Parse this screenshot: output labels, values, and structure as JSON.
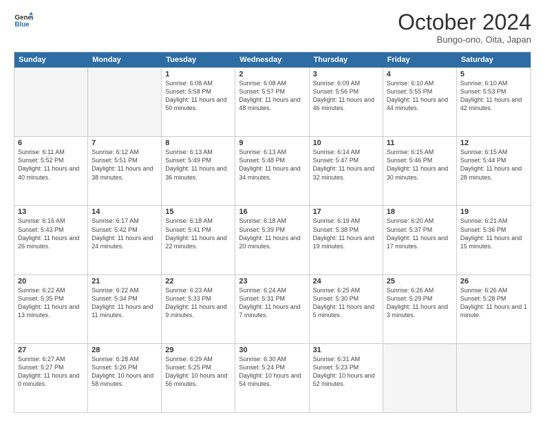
{
  "logo": {
    "line1": "General",
    "line2": "Blue"
  },
  "title": "October 2024",
  "location": "Bungo-ono, Oita, Japan",
  "header_days": [
    "Sunday",
    "Monday",
    "Tuesday",
    "Wednesday",
    "Thursday",
    "Friday",
    "Saturday"
  ],
  "rows": [
    [
      {
        "day": "",
        "info": ""
      },
      {
        "day": "",
        "info": ""
      },
      {
        "day": "1",
        "info": "Sunrise: 6:08 AM\nSunset: 5:58 PM\nDaylight: 11 hours and 50 minutes."
      },
      {
        "day": "2",
        "info": "Sunrise: 6:08 AM\nSunset: 5:57 PM\nDaylight: 11 hours and 48 minutes."
      },
      {
        "day": "3",
        "info": "Sunrise: 6:09 AM\nSunset: 5:56 PM\nDaylight: 11 hours and 46 minutes."
      },
      {
        "day": "4",
        "info": "Sunrise: 6:10 AM\nSunset: 5:55 PM\nDaylight: 11 hours and 44 minutes."
      },
      {
        "day": "5",
        "info": "Sunrise: 6:10 AM\nSunset: 5:53 PM\nDaylight: 11 hours and 42 minutes."
      }
    ],
    [
      {
        "day": "6",
        "info": "Sunrise: 6:11 AM\nSunset: 5:52 PM\nDaylight: 11 hours and 40 minutes."
      },
      {
        "day": "7",
        "info": "Sunrise: 6:12 AM\nSunset: 5:51 PM\nDaylight: 11 hours and 38 minutes."
      },
      {
        "day": "8",
        "info": "Sunrise: 6:13 AM\nSunset: 5:49 PM\nDaylight: 11 hours and 36 minutes."
      },
      {
        "day": "9",
        "info": "Sunrise: 6:13 AM\nSunset: 5:48 PM\nDaylight: 11 hours and 34 minutes."
      },
      {
        "day": "10",
        "info": "Sunrise: 6:14 AM\nSunset: 5:47 PM\nDaylight: 11 hours and 32 minutes."
      },
      {
        "day": "11",
        "info": "Sunrise: 6:15 AM\nSunset: 5:46 PM\nDaylight: 11 hours and 30 minutes."
      },
      {
        "day": "12",
        "info": "Sunrise: 6:15 AM\nSunset: 5:44 PM\nDaylight: 11 hours and 28 minutes."
      }
    ],
    [
      {
        "day": "13",
        "info": "Sunrise: 6:16 AM\nSunset: 5:43 PM\nDaylight: 11 hours and 26 minutes."
      },
      {
        "day": "14",
        "info": "Sunrise: 6:17 AM\nSunset: 5:42 PM\nDaylight: 11 hours and 24 minutes."
      },
      {
        "day": "15",
        "info": "Sunrise: 6:18 AM\nSunset: 5:41 PM\nDaylight: 11 hours and 22 minutes."
      },
      {
        "day": "16",
        "info": "Sunrise: 6:18 AM\nSunset: 5:39 PM\nDaylight: 11 hours and 20 minutes."
      },
      {
        "day": "17",
        "info": "Sunrise: 6:19 AM\nSunset: 5:38 PM\nDaylight: 11 hours and 19 minutes."
      },
      {
        "day": "18",
        "info": "Sunrise: 6:20 AM\nSunset: 5:37 PM\nDaylight: 11 hours and 17 minutes."
      },
      {
        "day": "19",
        "info": "Sunrise: 6:21 AM\nSunset: 5:36 PM\nDaylight: 11 hours and 15 minutes."
      }
    ],
    [
      {
        "day": "20",
        "info": "Sunrise: 6:22 AM\nSunset: 5:35 PM\nDaylight: 11 hours and 13 minutes."
      },
      {
        "day": "21",
        "info": "Sunrise: 6:22 AM\nSunset: 5:34 PM\nDaylight: 11 hours and 11 minutes."
      },
      {
        "day": "22",
        "info": "Sunrise: 6:23 AM\nSunset: 5:33 PM\nDaylight: 11 hours and 9 minutes."
      },
      {
        "day": "23",
        "info": "Sunrise: 6:24 AM\nSunset: 5:31 PM\nDaylight: 11 hours and 7 minutes."
      },
      {
        "day": "24",
        "info": "Sunrise: 6:25 AM\nSunset: 5:30 PM\nDaylight: 11 hours and 5 minutes."
      },
      {
        "day": "25",
        "info": "Sunrise: 6:26 AM\nSunset: 5:29 PM\nDaylight: 11 hours and 3 minutes."
      },
      {
        "day": "26",
        "info": "Sunrise: 6:26 AM\nSunset: 5:28 PM\nDaylight: 11 hours and 1 minute."
      }
    ],
    [
      {
        "day": "27",
        "info": "Sunrise: 6:27 AM\nSunset: 5:27 PM\nDaylight: 11 hours and 0 minutes."
      },
      {
        "day": "28",
        "info": "Sunrise: 6:28 AM\nSunset: 5:26 PM\nDaylight: 10 hours and 58 minutes."
      },
      {
        "day": "29",
        "info": "Sunrise: 6:29 AM\nSunset: 5:25 PM\nDaylight: 10 hours and 56 minutes."
      },
      {
        "day": "30",
        "info": "Sunrise: 6:30 AM\nSunset: 5:24 PM\nDaylight: 10 hours and 54 minutes."
      },
      {
        "day": "31",
        "info": "Sunrise: 6:31 AM\nSunset: 5:23 PM\nDaylight: 10 hours and 52 minutes."
      },
      {
        "day": "",
        "info": ""
      },
      {
        "day": "",
        "info": ""
      }
    ]
  ]
}
